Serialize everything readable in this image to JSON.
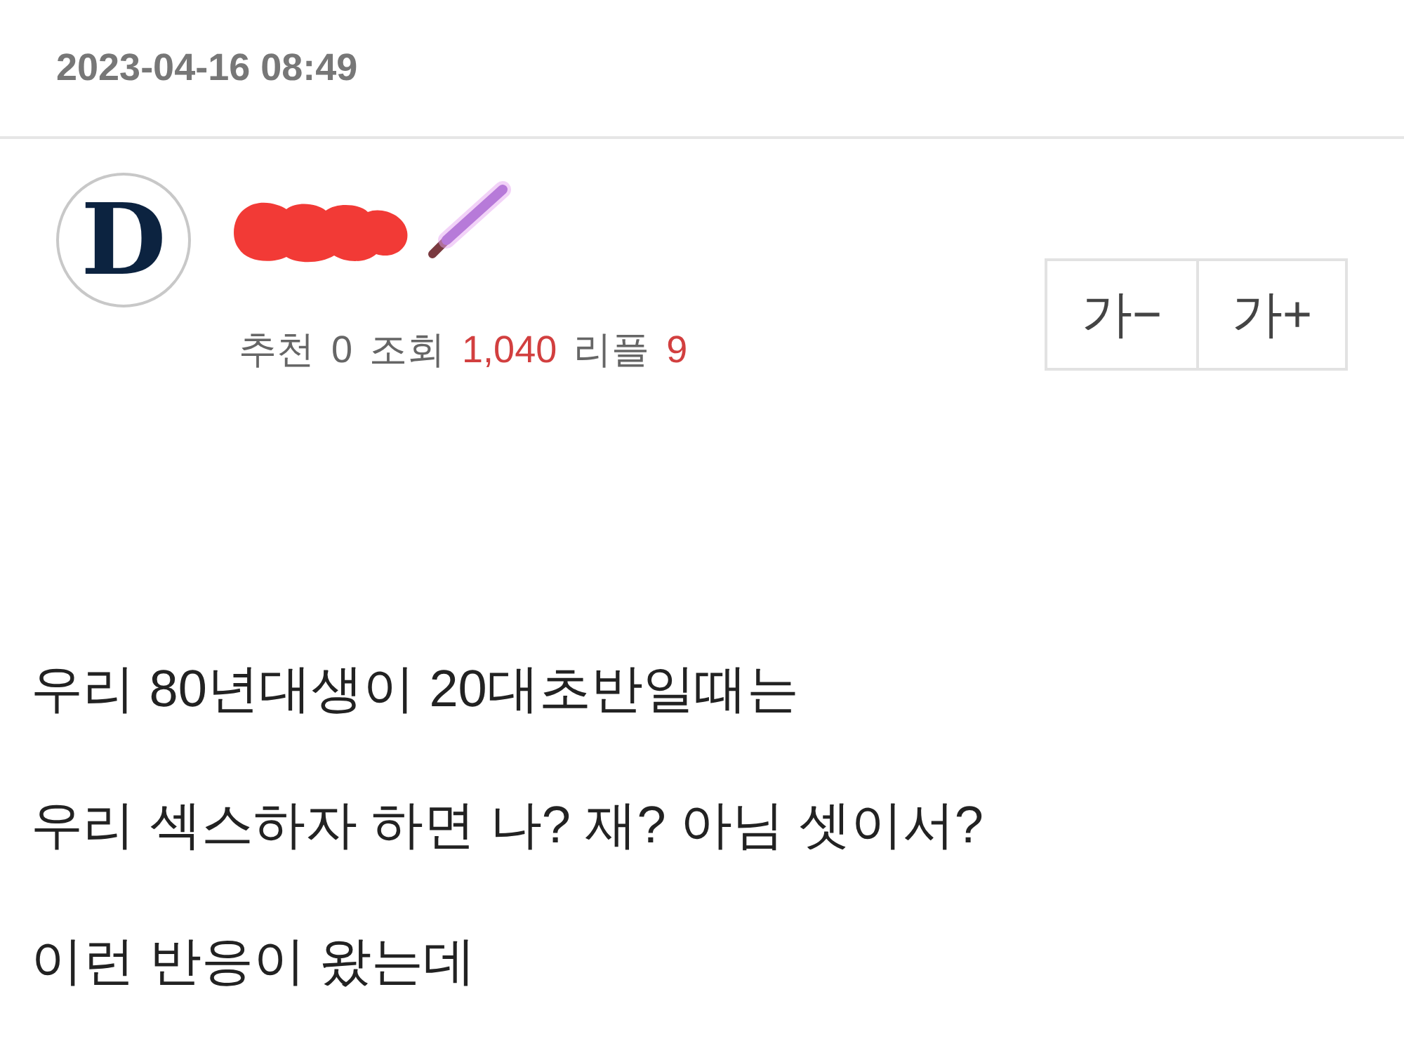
{
  "post": {
    "date": "2023-04-16 08:49"
  },
  "author": {
    "logo_letter": "D",
    "name_redacted": true
  },
  "stats": [
    {
      "label": "추천",
      "value": "0",
      "highlight": false
    },
    {
      "label": "조회",
      "value": "1,040",
      "highlight": true
    },
    {
      "label": "리플",
      "value": "9",
      "highlight": true
    }
  ],
  "font_size_buttons": [
    {
      "label": "가−"
    },
    {
      "label": "가+"
    }
  ],
  "body": {
    "paragraphs": [
      "우리 80년대생이 20대초반일때는",
      "우리 섹스하자 하면 나? 재? 아님 셋이서?",
      "이런 반응이 왔는데"
    ]
  }
}
